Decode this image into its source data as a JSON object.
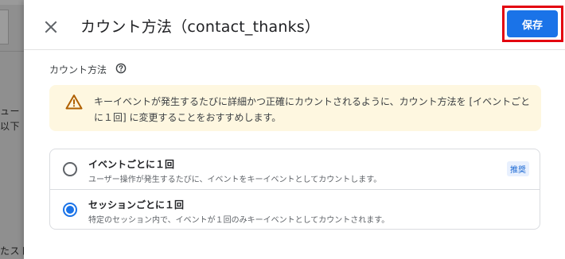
{
  "background": {
    "text_lines": [
      "ュー",
      "以下",
      "たスト"
    ]
  },
  "header": {
    "close_icon": "close-icon",
    "title": "カウント方法（contact_thanks）",
    "save_label": "保存"
  },
  "section": {
    "label": "カウント方法",
    "help_icon": "help-circle-icon"
  },
  "warning": {
    "icon": "warning-triangle-icon",
    "text": "キーイベントが発生するたびに詳細かつ正確にカウントされるように、カウント方法を [イベントごとに１回] に変更することをおすすめします。"
  },
  "options": [
    {
      "title": "イベントごとに１回",
      "description": "ユーザー操作が発生するたびに、イベントをキーイベントとしてカウントします。",
      "badge": "推奨",
      "selected": false
    },
    {
      "title": "セッションごとに１回",
      "description": "特定のセッション内で、イベントが１回のみキーイベントとしてカウントされます。",
      "badge": "",
      "selected": true
    }
  ],
  "colors": {
    "accent": "#1a73e8",
    "highlight_box": "#e3000f",
    "warning_bg": "#fef7e0",
    "warning_icon": "#b06000"
  }
}
